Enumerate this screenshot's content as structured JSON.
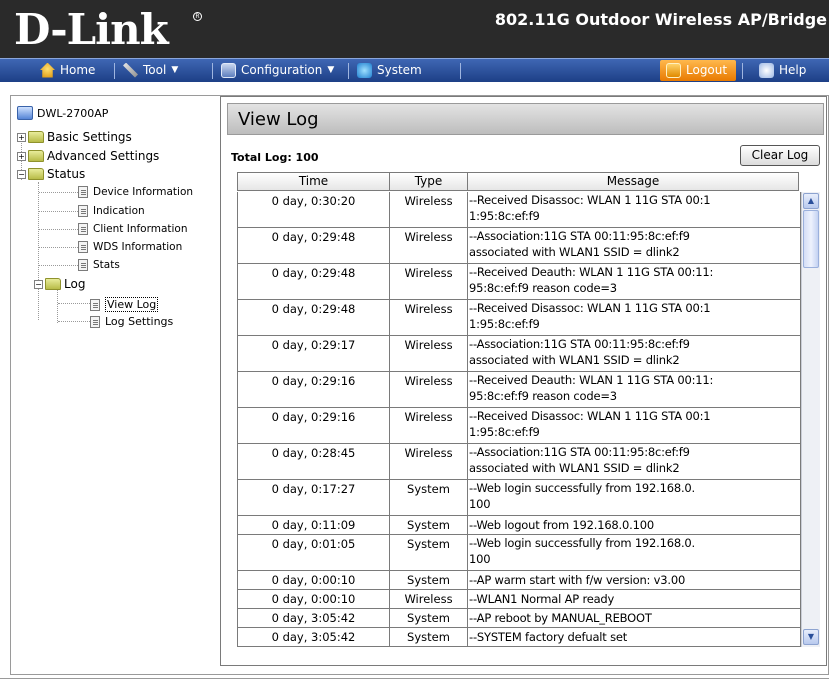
{
  "header": {
    "logo": "D-Link",
    "product": "802.11G Outdoor Wireless AP/Bridge"
  },
  "menu": {
    "home": "Home",
    "tool": "Tool",
    "configuration": "Configuration",
    "system": "System",
    "logout": "Logout",
    "help": "Help"
  },
  "tree": {
    "root": "DWL-2700AP",
    "basic": "Basic Settings",
    "advanced": "Advanced Settings",
    "status": "Status",
    "device_info": "Device Information",
    "indication": "Indication",
    "client_info": "Client Information",
    "wds_info": "WDS Information",
    "stats": "Stats",
    "log": "Log",
    "view_log": "View Log",
    "log_settings": "Log Settings"
  },
  "panel": {
    "title": "View Log",
    "total_label": "Total Log: 100",
    "clear_button": "Clear Log"
  },
  "table": {
    "columns": [
      "Time",
      "Type",
      "Message"
    ],
    "rows": [
      {
        "time": "0 day, 0:30:20",
        "type": "Wireless",
        "msg1": "--Received Disassoc: WLAN 1 11G STA 00:1",
        "msg2": "1:95:8c:ef:f9"
      },
      {
        "time": "0 day, 0:29:48",
        "type": "Wireless",
        "msg1": "--Association:11G STA 00:11:95:8c:ef:f9",
        "msg2": "associated with WLAN1 SSID = dlink2"
      },
      {
        "time": "0 day, 0:29:48",
        "type": "Wireless",
        "msg1": "--Received Deauth: WLAN 1 11G STA 00:11:",
        "msg2": "95:8c:ef:f9 reason code=3"
      },
      {
        "time": "0 day, 0:29:48",
        "type": "Wireless",
        "msg1": "--Received Disassoc: WLAN 1 11G STA 00:1",
        "msg2": "1:95:8c:ef:f9"
      },
      {
        "time": "0 day, 0:29:17",
        "type": "Wireless",
        "msg1": "--Association:11G STA 00:11:95:8c:ef:f9",
        "msg2": "associated with WLAN1 SSID = dlink2"
      },
      {
        "time": "0 day, 0:29:16",
        "type": "Wireless",
        "msg1": "--Received Deauth: WLAN 1 11G STA 00:11:",
        "msg2": "95:8c:ef:f9 reason code=3"
      },
      {
        "time": "0 day, 0:29:16",
        "type": "Wireless",
        "msg1": "--Received Disassoc: WLAN 1 11G STA 00:1",
        "msg2": "1:95:8c:ef:f9"
      },
      {
        "time": "0 day, 0:28:45",
        "type": "Wireless",
        "msg1": "--Association:11G STA 00:11:95:8c:ef:f9",
        "msg2": "associated with WLAN1 SSID = dlink2"
      },
      {
        "time": "0 day, 0:17:27",
        "type": "System",
        "msg1": "--Web login successfully from 192.168.0.",
        "msg2": "100"
      },
      {
        "time": "0 day, 0:11:09",
        "type": "System",
        "msg1": "--Web logout from 192.168.0.100",
        "msg2": ""
      },
      {
        "time": "0 day, 0:01:05",
        "type": "System",
        "msg1": "--Web login successfully from 192.168.0.",
        "msg2": "100"
      },
      {
        "time": "0 day, 0:00:10",
        "type": "System",
        "msg1": "--AP warm start with f/w version: v3.00",
        "msg2": ""
      },
      {
        "time": "0 day, 0:00:10",
        "type": "Wireless",
        "msg1": "--WLAN1 Normal AP ready",
        "msg2": ""
      },
      {
        "time": "0 day, 3:05:42",
        "type": "System",
        "msg1": "--AP reboot by MANUAL_REBOOT",
        "msg2": ""
      },
      {
        "time": "0 day, 3:05:42",
        "type": "System",
        "msg1": "--SYSTEM factory defualt set",
        "msg2": ""
      }
    ]
  }
}
